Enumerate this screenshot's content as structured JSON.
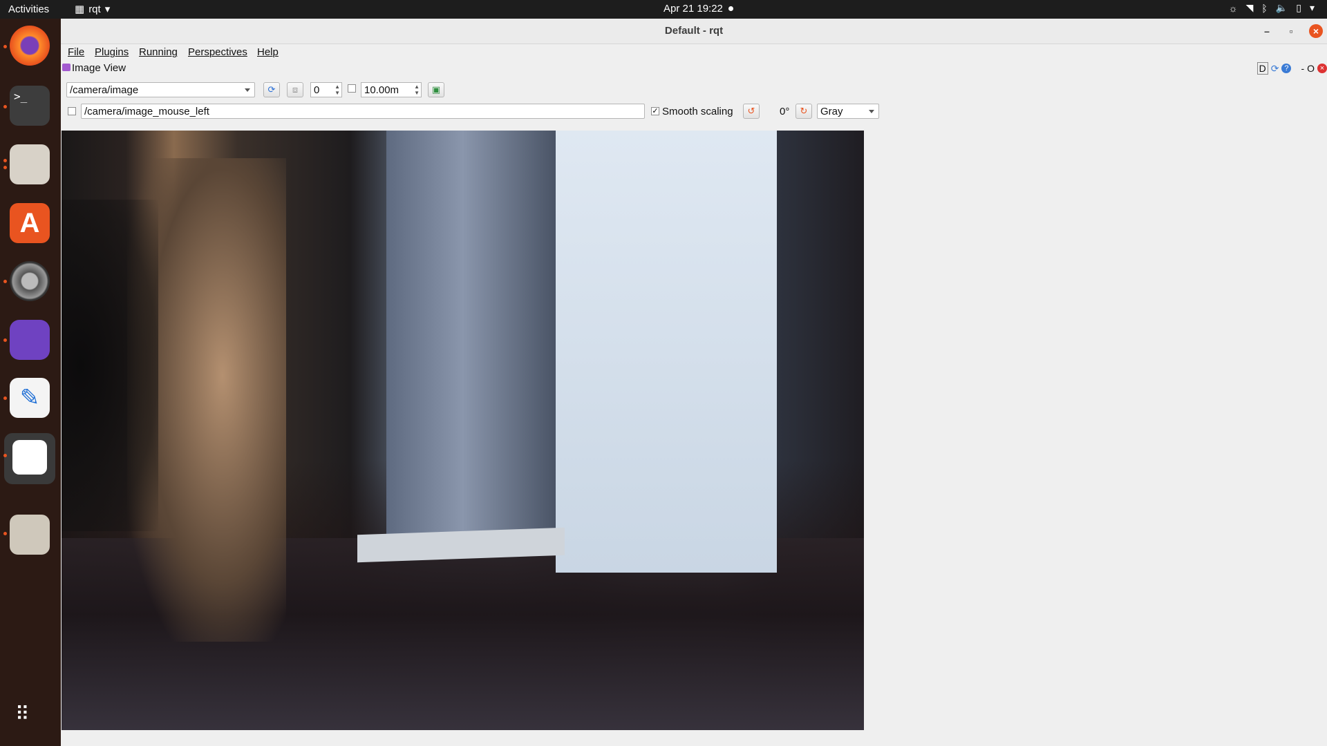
{
  "topbar": {
    "activities": "Activities",
    "app_name": "rqt",
    "clock": "Apr 21  19:22"
  },
  "dock": {
    "items": [
      "firefox-icon",
      "terminal-icon",
      "files-icon",
      "app-store-icon",
      "settings-icon",
      "github-icon",
      "text-editor-icon",
      "show-apps-dots-icon",
      "magnifier-icon"
    ]
  },
  "window": {
    "title": "Default - rqt",
    "menu": [
      "File",
      "Plugins",
      "Running",
      "Perspectives",
      "Help"
    ],
    "plugin_title": "Image View",
    "plugin_controls": {
      "d": "D",
      "dash": "-",
      "o": "O"
    }
  },
  "toolbar": {
    "topic": "/camera/image",
    "spin_value": "0",
    "duration": "10.00m",
    "mouse_topic": "/camera/image_mouse_left",
    "smooth_scaling_label": "Smooth scaling",
    "smooth_scaling_checked": true,
    "rotation": "0°",
    "color_scheme": "Gray"
  },
  "colors": {
    "accent": "#e95420",
    "dock_bg": "#2c1a14",
    "topbar_bg": "#1d1d1d"
  }
}
